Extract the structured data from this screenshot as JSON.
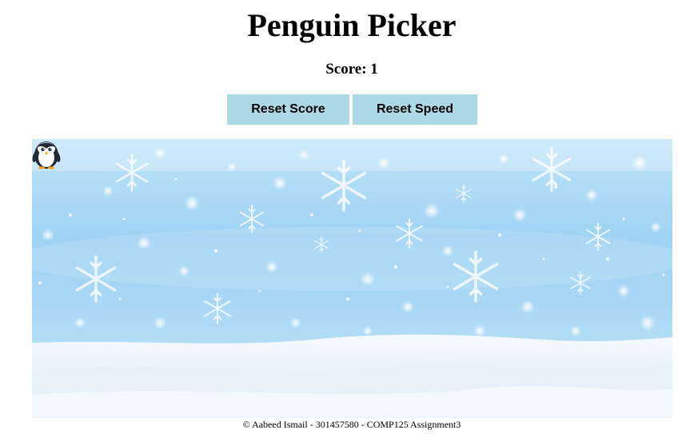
{
  "header": {
    "title": "Penguin Picker",
    "score_label": "Score: 1"
  },
  "controls": {
    "reset_score_label": "Reset Score",
    "reset_speed_label": "Reset Speed",
    "button_color": "#add8e6"
  },
  "game": {
    "background_theme": "winter-snowflakes",
    "sky_color": "#a9d8f5",
    "snow_color": "#eef6fb",
    "sprite": "penguin-icon"
  },
  "footer": {
    "text": "© Aabeed Ismail - 301457580 - COMP125 Assignment3"
  }
}
